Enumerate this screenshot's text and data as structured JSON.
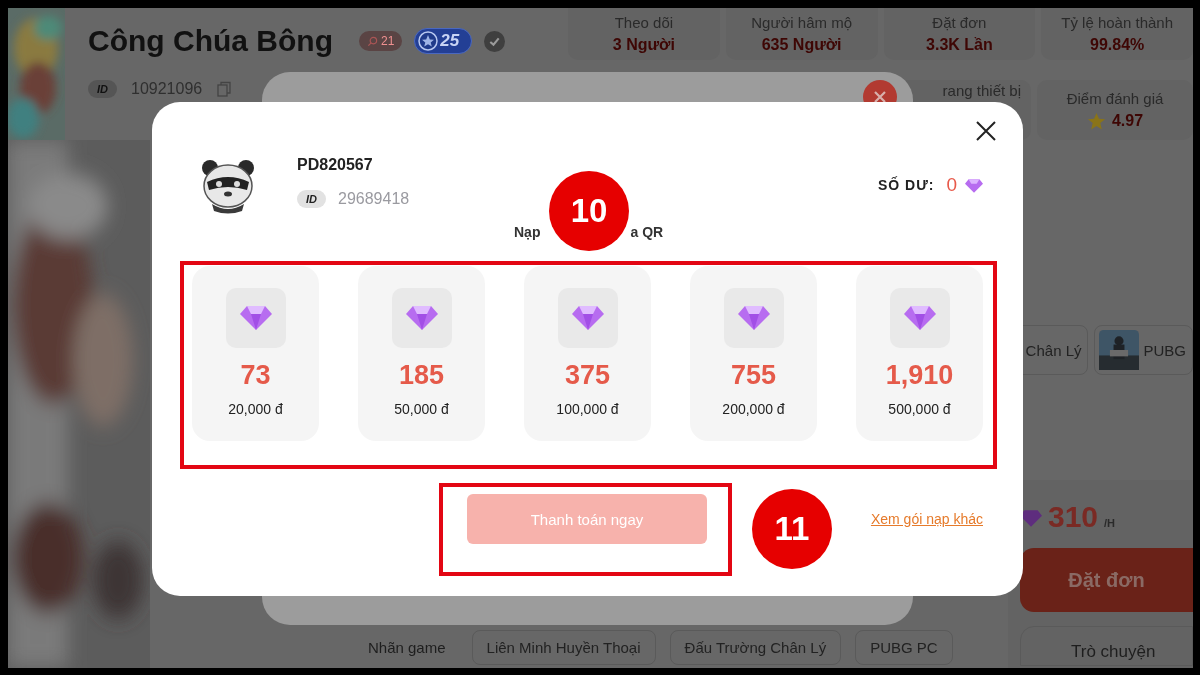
{
  "profile": {
    "name": "Công Chúa Bông",
    "like_count": "21",
    "level": "25",
    "verified": true,
    "id_label": "ID",
    "id": "10921096"
  },
  "stats": [
    {
      "label": "Theo dõi",
      "value": "3 Người"
    },
    {
      "label": "Người hâm mộ",
      "value": "635 Người"
    },
    {
      "label": "Đặt đơn",
      "value": "3.3K Lần"
    },
    {
      "label": "Tỷ lệ hoàn thành",
      "value": "99.84%"
    }
  ],
  "stats_row_2": [
    {
      "label": "rang thiết bị"
    },
    {
      "label": "Điểm đánh giá",
      "value": "4.97"
    }
  ],
  "game_chips": [
    {
      "label": "Chân Lý",
      "kind": "text"
    },
    {
      "label": "PUBG"
    }
  ],
  "price": {
    "value": "310",
    "unit": "/H",
    "order_button": "Đặt đơn",
    "chat_button": "Trò chuyện"
  },
  "game_tags": {
    "label": "Nhãn game",
    "tags": [
      "Liên Minh Huyền Thoại",
      "Đấu Trường Chân Lý",
      "PUBG PC"
    ]
  },
  "topup_dialog": {
    "username": "PD820567",
    "id_label": "ID",
    "user_id": "29689418",
    "balance_label": "SỐ DƯ:",
    "balance": "0",
    "title_parts": [
      "Nạp",
      "a QR"
    ],
    "packages": [
      {
        "diamonds": "73",
        "price": "20,000 đ"
      },
      {
        "diamonds": "185",
        "price": "50,000 đ"
      },
      {
        "diamonds": "375",
        "price": "100,000 đ"
      },
      {
        "diamonds": "755",
        "price": "200,000 đ"
      },
      {
        "diamonds": "1,910",
        "price": "500,000 đ"
      }
    ],
    "pay_button": {
      "label": "Thanh toán ngay",
      "disabled": true
    },
    "more_link": "Xem gói nạp khác"
  },
  "callouts": [
    {
      "number": "10"
    },
    {
      "number": "11"
    }
  ]
}
